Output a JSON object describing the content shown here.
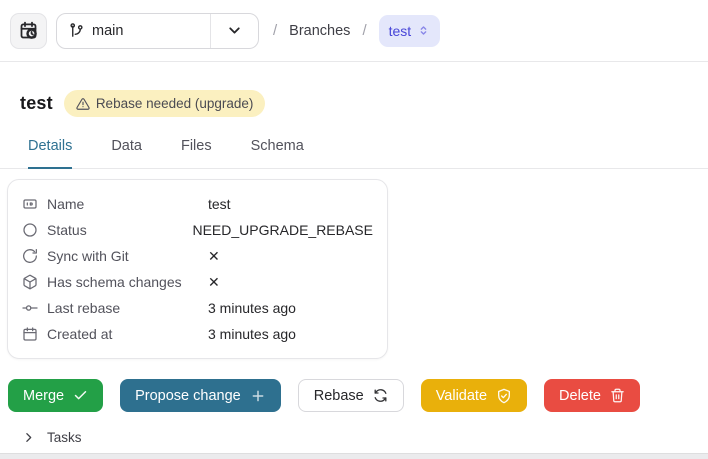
{
  "topbar": {
    "history_button_icon": "calendar-clock-icon",
    "branch_selector": {
      "icon": "git-branch-icon",
      "value": "main",
      "chevron": "chevron-down-icon"
    },
    "breadcrumb": {
      "separator": "/",
      "section": "Branches",
      "current_branch": "test",
      "current_branch_icon": "chevrons-up-down-icon"
    }
  },
  "header": {
    "title": "test",
    "badge": {
      "icon": "warning-triangle-icon",
      "label": "Rebase needed (upgrade)"
    }
  },
  "tabs": [
    {
      "label": "Details",
      "active": true
    },
    {
      "label": "Data",
      "active": false
    },
    {
      "label": "Files",
      "active": false
    },
    {
      "label": "Schema",
      "active": false
    }
  ],
  "details": {
    "rows": [
      {
        "icon": "id-card-icon",
        "label": "Name",
        "value": "test"
      },
      {
        "icon": "circle-icon",
        "label": "Status",
        "value": "NEED_UPGRADE_REBASE"
      },
      {
        "icon": "sync-icon",
        "label": "Sync with Git",
        "value": "✕"
      },
      {
        "icon": "cube-icon",
        "label": "Has schema changes",
        "value": "✕"
      },
      {
        "icon": "git-commit-icon",
        "label": "Last rebase",
        "value": "3 minutes ago"
      },
      {
        "icon": "calendar-icon",
        "label": "Created at",
        "value": "3 minutes ago"
      }
    ]
  },
  "actions": [
    {
      "label": "Merge",
      "icon": "check-icon",
      "color": "#23a047"
    },
    {
      "label": "Propose change",
      "icon": "plus-icon",
      "color": "#2e708f"
    },
    {
      "label": "Rebase",
      "icon": "refresh-icon",
      "color": "#ffffff"
    },
    {
      "label": "Validate",
      "icon": "shield-check-icon",
      "color": "#e9b00b"
    },
    {
      "label": "Delete",
      "icon": "trash-icon",
      "color": "#e94c42"
    }
  ],
  "tasks": {
    "label": "Tasks",
    "icon": "chevron-right-icon"
  },
  "colors": {
    "accent_tab": "#2e7191",
    "badge_bg": "#fbf0c0",
    "branch_pill_bg": "#e4e7fb",
    "branch_pill_text": "#4745d8",
    "merge_green": "#23a047",
    "propose_teal": "#2e708f",
    "validate_amber": "#e9b00b",
    "delete_red": "#e94c42"
  }
}
